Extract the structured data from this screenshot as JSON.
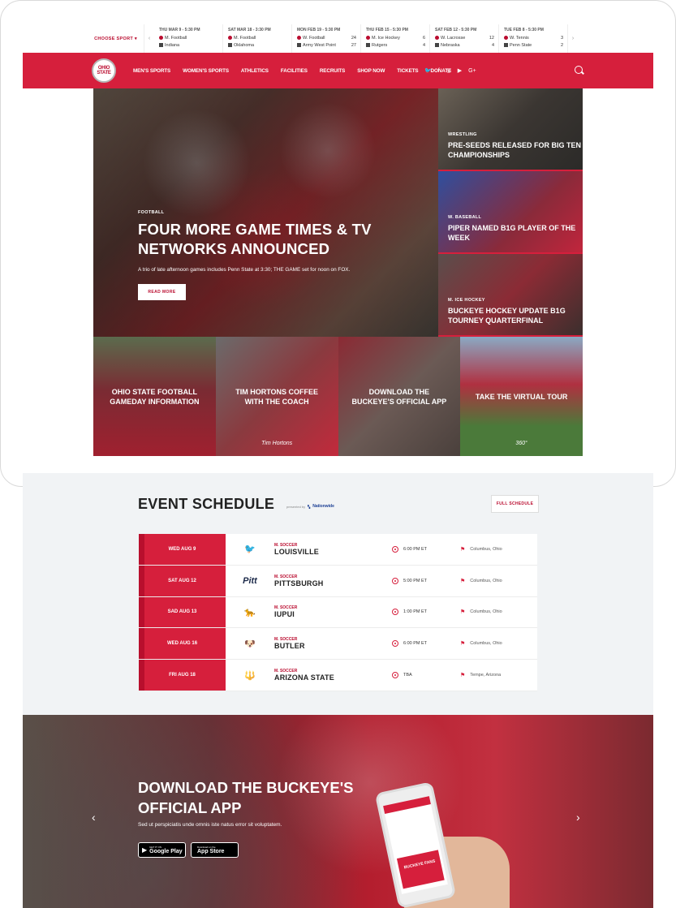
{
  "scores": {
    "choose_label": "CHOOSE SPORT",
    "prev_arrow": "‹",
    "next_arrow": "›",
    "games": [
      {
        "date": "THU MAR 9 - 5:30 PM",
        "team1": "M. Football",
        "score1": "",
        "team2": "Indiana",
        "score2": ""
      },
      {
        "date": "SAT MAR 18 - 3:30 PM",
        "team1": "M. Football",
        "score1": "",
        "team2": "Oklahoma",
        "score2": ""
      },
      {
        "date": "MON FEB 19 - 5:30 PM",
        "team1": "W. Football",
        "score1": "24",
        "team2": "Army West Point",
        "score2": "27"
      },
      {
        "date": "THU FEB 15 - 5:30 PM",
        "team1": "M. Ice Hockey",
        "score1": "6",
        "team2": "Rutgers",
        "score2": "4"
      },
      {
        "date": "SAT FEB 12 - 5:30 PM",
        "team1": "W. Lacrosse",
        "score1": "12",
        "team2": "Nebraska",
        "score2": "4"
      },
      {
        "date": "TUE FEB 8 - 5:30 PM",
        "team1": "W. Tennis",
        "score1": "3",
        "team2": "Penn State",
        "score2": "2"
      }
    ]
  },
  "nav": {
    "logo_text": "OHIO STATE",
    "items": [
      "MEN'S SPORTS",
      "WOMEN'S SPORTS",
      "ATHLETICS",
      "FACILITIES",
      "RECRUITS",
      "SHOP NOW",
      "TICKETS",
      "DONATE"
    ],
    "social": [
      "twitter-icon",
      "facebook-icon",
      "instagram-icon",
      "youtube-icon",
      "google-plus-icon"
    ]
  },
  "hero": {
    "category": "FOOTBALL",
    "title": "FOUR MORE GAME TIMES & TV NETWORKS ANNOUNCED",
    "description": "A trio of late afternoon games includes Penn State at 3:30; THE GAME set for noon on FOX.",
    "button": "READ MORE"
  },
  "side_stories": [
    {
      "category": "WRESTLING",
      "title": "PRE-SEEDS RELEASED FOR BIG TEN CHAMPIONSHIPS"
    },
    {
      "category": "W. BASEBALL",
      "title": "PIPER NAMED B1G PLAYER OF THE WEEK"
    },
    {
      "category": "M. ICE HOCKEY",
      "title": "BUCKEYE HOCKEY UPDATE B1G TOURNEY QUARTERFINAL"
    }
  ],
  "tiles": [
    {
      "title": "OHIO STATE FOOTBALL GAMEDAY INFORMATION",
      "foot": ""
    },
    {
      "title": "TIM HORTONS COFFEE WITH THE COACH",
      "foot": "Tim Hortons"
    },
    {
      "title": "DOWNLOAD THE BUCKEYE'S OFFICIAL APP",
      "foot": ""
    },
    {
      "title": "TAKE THE VIRTUAL TOUR",
      "foot": "360°"
    }
  ],
  "schedule": {
    "heading": "EVENT SCHEDULE",
    "presented_by": "presented by",
    "sponsor": "Nationwide",
    "full_schedule": "FULL SCHEDULE",
    "events": [
      {
        "date": "WED AUG 9",
        "sport": "M. SOCCER",
        "team": "LOUISVILLE",
        "time": "6:00 PM ET",
        "location": "Columbus, Ohio",
        "logo": "🐦"
      },
      {
        "date": "SAT AUG 12",
        "sport": "M. SOCCER",
        "team": "PITTSBURGH",
        "time": "5:00 PM ET",
        "location": "Columbus, Ohio",
        "logo": "Pitt"
      },
      {
        "date": "SAD AUG 13",
        "sport": "M. SOCCER",
        "team": "IUPUI",
        "time": "1:00 PM ET",
        "location": "Columbus, Ohio",
        "logo": "🐆"
      },
      {
        "date": "WED AUG 16",
        "sport": "M. SOCCER",
        "team": "BUTLER",
        "time": "6:00 PM ET",
        "location": "Columbus, Ohio",
        "logo": "🐶"
      },
      {
        "date": "FRI AUG 18",
        "sport": "M. SOCCER",
        "team": "ARIZONA STATE",
        "time": "TBA",
        "location": "Tempe, Arizona",
        "logo": "🔱"
      }
    ]
  },
  "app": {
    "title": "DOWNLOAD THE BUCKEYE'S OFFICIAL APP",
    "subtitle": "Sed ut perspiciatis unde omnis iste natus error sit voluptatem.",
    "google_small": "GET IT ON",
    "google": "Google Play",
    "apple_small": "Download on the",
    "apple": "App Store",
    "phone_banner": "BUCKEYE FANS"
  }
}
